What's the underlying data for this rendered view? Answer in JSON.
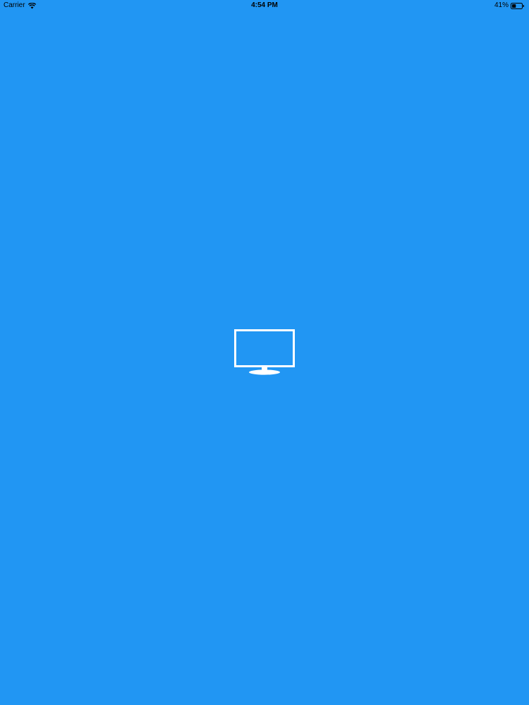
{
  "status_bar": {
    "carrier": "Carrier",
    "time": "4:54 PM",
    "battery_percent": "41%",
    "battery_level": 0.41
  },
  "colors": {
    "background": "#2196F3",
    "icon": "#FFFFFF",
    "status_text": "#000000"
  },
  "icons": {
    "wifi": "wifi-icon",
    "battery": "battery-icon",
    "center": "monitor-icon"
  }
}
